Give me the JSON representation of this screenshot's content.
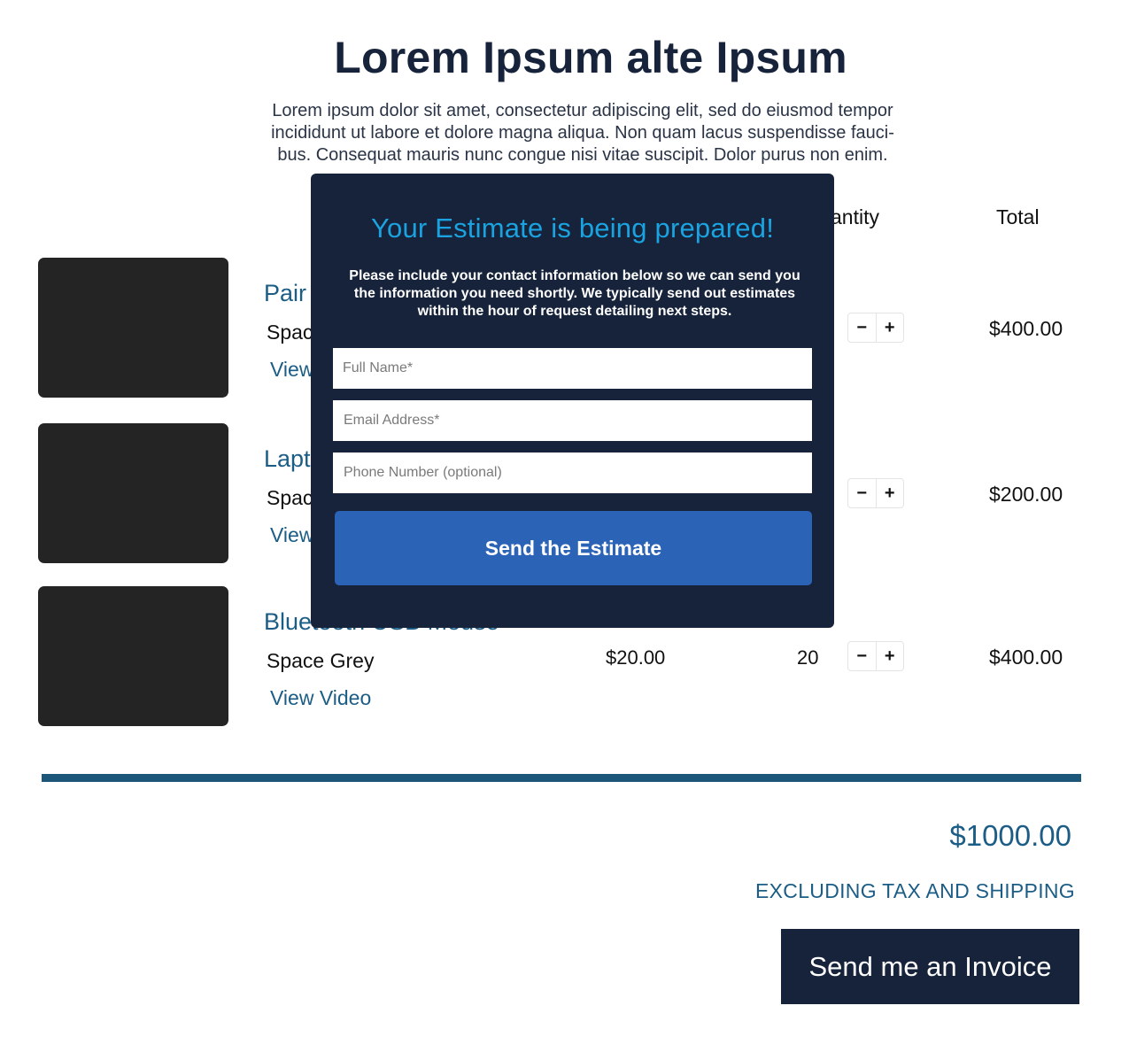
{
  "page": {
    "title": "Lorem Ipsum alte Ipsum",
    "intro_lines": [
      "Lorem ipsum dolor sit amet, consectetur adipiscing elit, sed do eiusmod tempor",
      "incididunt ut labore et dolore magna aliqua. Non quam lacus suspendisse fauci-",
      "bus. Consequat mauris nunc congue nisi vitae suscipit. Dolor purus non enim."
    ]
  },
  "table": {
    "headers": {
      "quantity": "antity",
      "total": "Total"
    },
    "rows": [
      {
        "name": "Pair",
        "color": "Spac",
        "video": "View",
        "price": "",
        "quantity": "",
        "minus": "−",
        "plus": "+",
        "total": "$400.00"
      },
      {
        "name": "Lapt",
        "color": "Spac",
        "video": "View",
        "price": "",
        "quantity": "",
        "minus": "−",
        "plus": "+",
        "total": "$200.00"
      },
      {
        "name": "Bluetooth USB Mouse",
        "color": "Space Grey",
        "video": "View Video",
        "price": "$20.00",
        "quantity": "20",
        "minus": "−",
        "plus": "+",
        "total": "$400.00"
      }
    ]
  },
  "summary": {
    "grand_total": "$1000.00",
    "note": "EXCLUDING TAX AND SHIPPING",
    "invoice_button": "Send me an Invoice"
  },
  "modal": {
    "title": "Your Estimate is being prepared!",
    "description_lines": [
      "Please include your contact information below  so we can send you",
      "the information you need shortly. We typically send out estimates",
      "within the hour of request detailing next steps."
    ],
    "fields": {
      "full_name": {
        "value": "",
        "placeholder": "Full Name*"
      },
      "email": {
        "value": "",
        "placeholder": "Email Address*"
      },
      "phone": {
        "value": "",
        "placeholder": "Phone Number (optional)"
      }
    },
    "submit_label": "Send the Estimate"
  },
  "colors": {
    "navy": "#16233a",
    "link_blue": "#1c5d86",
    "modal_title": "#1aa3e0",
    "button_blue": "#2b63b6",
    "thumbnail": "#242424"
  }
}
